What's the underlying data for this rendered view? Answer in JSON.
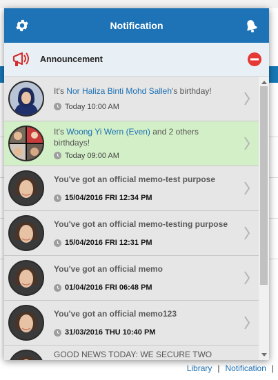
{
  "popup": {
    "title": "Notification",
    "settings_icon": "gear-icon",
    "bell_icon": "bell-icon"
  },
  "announcement": {
    "label": "Announcement",
    "icon": "megaphone-icon",
    "collapse_icon": "minus-circle-icon"
  },
  "notifications": [
    {
      "prefix": "It's ",
      "name": "Nor Haliza Binti Mohd Salleh",
      "suffix": "'s birthday!",
      "time": "Today 10:00 AM"
    },
    {
      "prefix": "It's ",
      "name": "Woong Yi Wern (Even)",
      "suffix": " and 2 others birthdays!",
      "time": "Today 09:00 AM"
    },
    {
      "text": "You've got an official memo-test purpose",
      "time": "15/04/2016 FRI 12:34 PM"
    },
    {
      "text": "You've got an official memo-testing purpose",
      "time": "15/04/2016 FRI 12:31 PM"
    },
    {
      "text": "You've got an official memo",
      "time": "01/04/2016 FRI 06:48 PM"
    },
    {
      "text": "You've got an official memo123",
      "time": "31/03/2016 THU 10:40 PM"
    },
    {
      "text": "GOOD NEWS TODAY: WE SECURE TWO"
    }
  ],
  "footer": {
    "library": "Library",
    "separator": "|",
    "notification": "Notification"
  },
  "colors": {
    "header": "#1d73b6",
    "highlight": "#d3efc7",
    "link": "#1a6fb3",
    "alert_red": "#e53935"
  }
}
